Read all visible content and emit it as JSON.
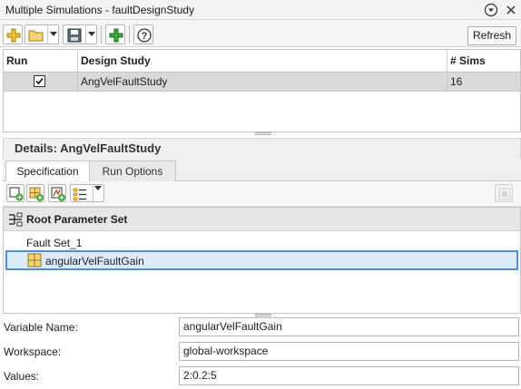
{
  "window": {
    "title": "Multiple Simulations - faultDesignStudy"
  },
  "toolbar": {
    "refresh_label": "Refresh"
  },
  "table": {
    "columns": [
      "Run",
      "Design Study",
      "# Sims"
    ],
    "rows": [
      {
        "run_checked": true,
        "design_study": "AngVelFaultStudy",
        "sims": "16"
      }
    ]
  },
  "details": {
    "header": "Details: AngVelFaultStudy",
    "tabs": [
      "Specification",
      "Run Options"
    ],
    "active_tab": "Specification"
  },
  "tree": {
    "root_label": "Root Parameter Set",
    "children": [
      {
        "label": "Fault Set_1"
      },
      {
        "label": "angularVelFaultGain",
        "selected": true
      }
    ]
  },
  "form": {
    "variable_name_label": "Variable Name:",
    "variable_name_value": "angularVelFaultGain",
    "workspace_label": "Workspace:",
    "workspace_value": "global-workspace",
    "values_label": "Values:",
    "values_value": "2:0.2:5"
  },
  "colors": {
    "selection_border": "#4a90d9",
    "selection_fill": "#dcebfa",
    "icon_yellow": "#f2c12e",
    "icon_green": "#3fa535"
  }
}
